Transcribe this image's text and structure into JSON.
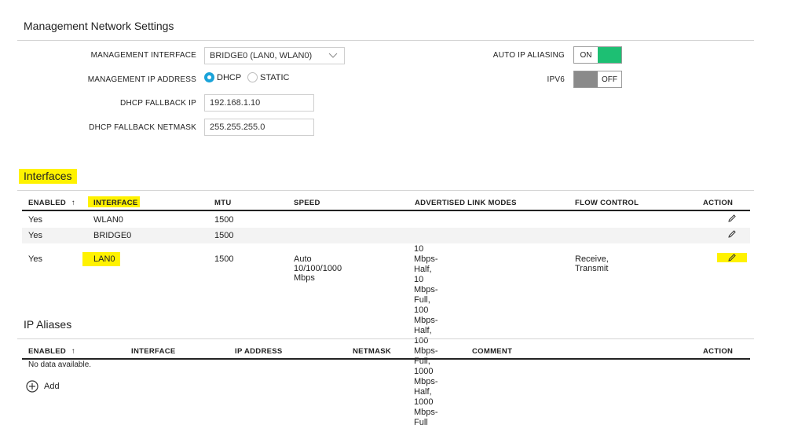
{
  "management": {
    "title": "Management Network Settings",
    "interface_label": "MANAGEMENT INTERFACE",
    "interface_value": "BRIDGE0 (LAN0, WLAN0)",
    "ip_address_label": "MANAGEMENT IP ADDRESS",
    "ip_options": [
      {
        "label": "DHCP",
        "selected": true
      },
      {
        "label": "STATIC",
        "selected": false
      }
    ],
    "fallback_ip_label": "DHCP FALLBACK IP",
    "fallback_ip_value": "192.168.1.10",
    "fallback_netmask_label": "DHCP FALLBACK NETMASK",
    "fallback_netmask_value": "255.255.255.0",
    "auto_ip_aliasing_label": "AUTO IP ALIASING",
    "auto_ip_aliasing_state": "ON",
    "ipv6_label": "IPV6",
    "ipv6_state": "OFF",
    "toggle_on_color": "#1dbf73",
    "toggle_off_color": "#8a8a8a",
    "radio_color": "#1aa3d9"
  },
  "interfaces": {
    "title": "Interfaces",
    "headers": {
      "enabled": "ENABLED",
      "sort_icon": "↑",
      "interface": "INTERFACE",
      "mtu": "MTU",
      "speed": "SPEED",
      "advertised": "ADVERTISED LINK MODES",
      "flow": "FLOW CONTROL",
      "action": "ACTION"
    },
    "rows": [
      {
        "enabled": "Yes",
        "interface": "WLAN0",
        "mtu": "1500",
        "speed": "",
        "advertised": "",
        "flow": "",
        "action_icon": "pencil-icon"
      },
      {
        "enabled": "Yes",
        "interface": "BRIDGE0",
        "mtu": "1500",
        "speed": "",
        "advertised": "",
        "flow": "",
        "action_icon": "pencil-icon"
      },
      {
        "enabled": "Yes",
        "interface": "LAN0",
        "mtu": "1500",
        "speed": "Auto 10/100/1000 Mbps",
        "advertised": [
          "10 Mbps-Half, 10 Mbps-Full, 100",
          "Mbps-Half, 100 Mbps-Full, 1000",
          "Mbps-Half, 1000 Mbps-Full"
        ],
        "flow": "Receive, Transmit",
        "action_icon": "pencil-icon"
      }
    ],
    "highlight_color": "#fff200"
  },
  "ip_aliases": {
    "title": "IP Aliases",
    "headers": {
      "enabled": "ENABLED",
      "sort_icon": "↑",
      "interface": "INTERFACE",
      "ip_address": "IP ADDRESS",
      "netmask": "NETMASK",
      "comment": "COMMENT",
      "action": "ACTION"
    },
    "empty_text": "No data available.",
    "add_label": "Add",
    "add_icon": "plus-circle-icon"
  }
}
